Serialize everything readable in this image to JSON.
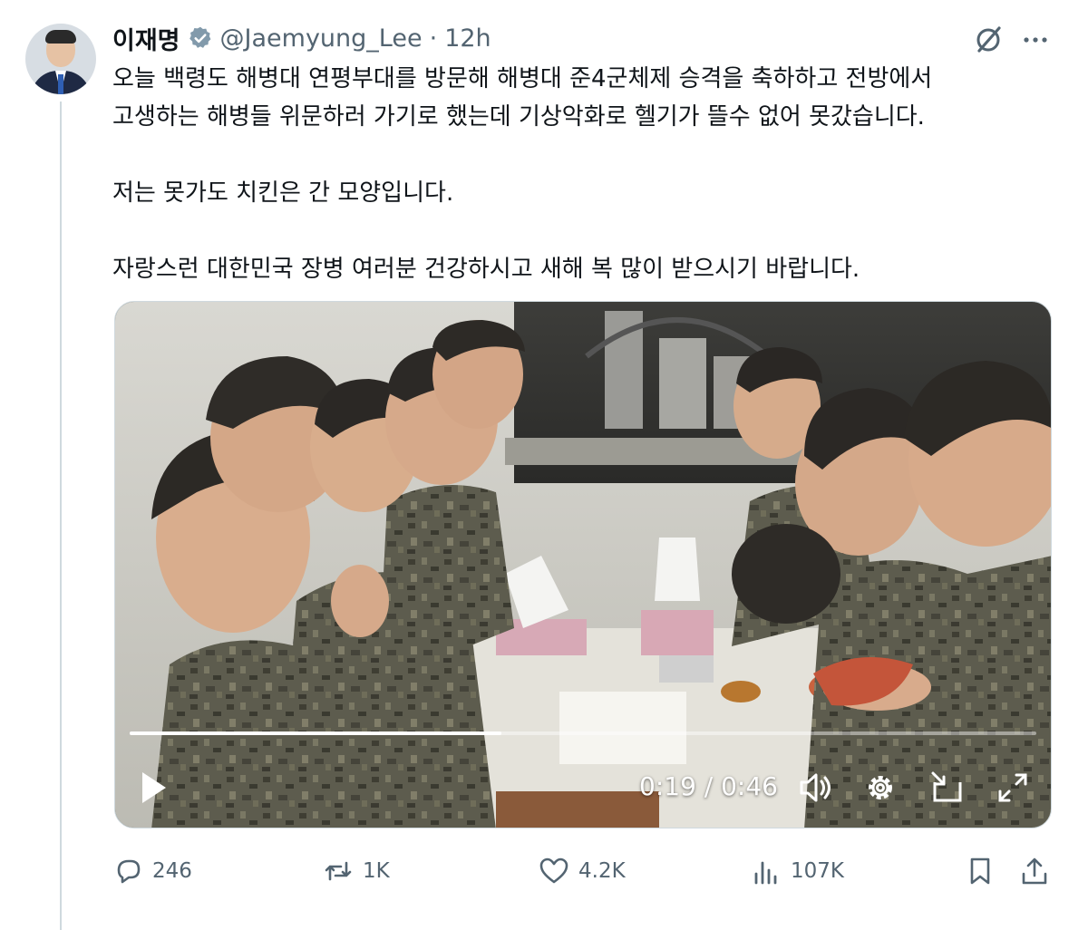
{
  "author": {
    "name": "이재명",
    "handle": "@Jaemyung_Lee",
    "separator": "·",
    "time": "12h",
    "verified": true
  },
  "tweet": {
    "line1": "오늘 백령도 해병대 연평부대를 방문해 해병대 준4군체제 승격을 축하하고 전방에서",
    "line2": "고생하는 해병들 위문하러 가기로 했는데 기상악화로 헬기가 뜰수 없어 못갔습니다.",
    "line3": "저는 못가도 치킨은 간 모양입니다.",
    "line4": "자랑스런 대한민국 장병 여러분 건강하시고 새해 복 많이 받으시기 바랍니다."
  },
  "video": {
    "current_time": "0:19",
    "duration": "0:46",
    "time_display": "0:19 / 0:46",
    "progress_fraction": 0.41
  },
  "actions": {
    "replies": "246",
    "reposts": "1K",
    "likes": "4.2K",
    "views": "107K"
  },
  "icons": {
    "verified": "verified-badge-icon",
    "grok": "grok-icon",
    "more": "more-icon",
    "play": "play-icon",
    "volume": "volume-icon",
    "settings": "settings-icon",
    "pip": "picture-in-picture-icon",
    "fullscreen": "fullscreen-icon",
    "reply": "reply-icon",
    "repost": "repost-icon",
    "like": "like-icon",
    "views": "views-icon",
    "bookmark": "bookmark-icon",
    "share": "share-icon"
  },
  "colors": {
    "text": "#0f1419",
    "secondary": "#536471",
    "verified_fill": "#829aab",
    "divider": "#cfd9de"
  }
}
